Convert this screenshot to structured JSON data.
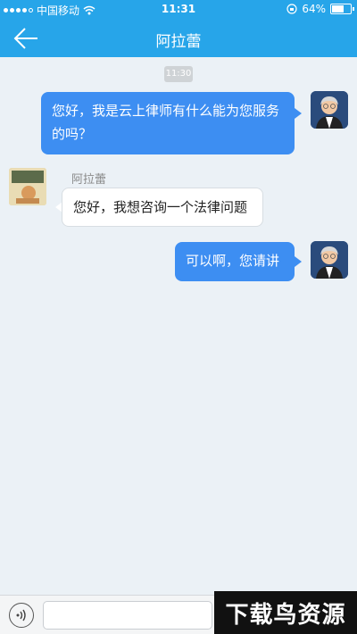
{
  "status_bar": {
    "carrier": "中国移动",
    "time": "11:31",
    "battery": "64%",
    "battery_level": 0.64
  },
  "nav": {
    "title": "阿拉蕾"
  },
  "chat": {
    "timestamp": "11:30",
    "messages": [
      {
        "direction": "out",
        "text": "您好，我是云上律师有什么能为您服务的吗？"
      },
      {
        "direction": "in",
        "sender": "阿拉蕾",
        "text": "您好，我想咨询一个法律问题"
      },
      {
        "direction": "out",
        "text": "可以啊，您请讲"
      }
    ]
  },
  "input_bar": {
    "value": ""
  },
  "watermark": "下载鸟资源"
}
